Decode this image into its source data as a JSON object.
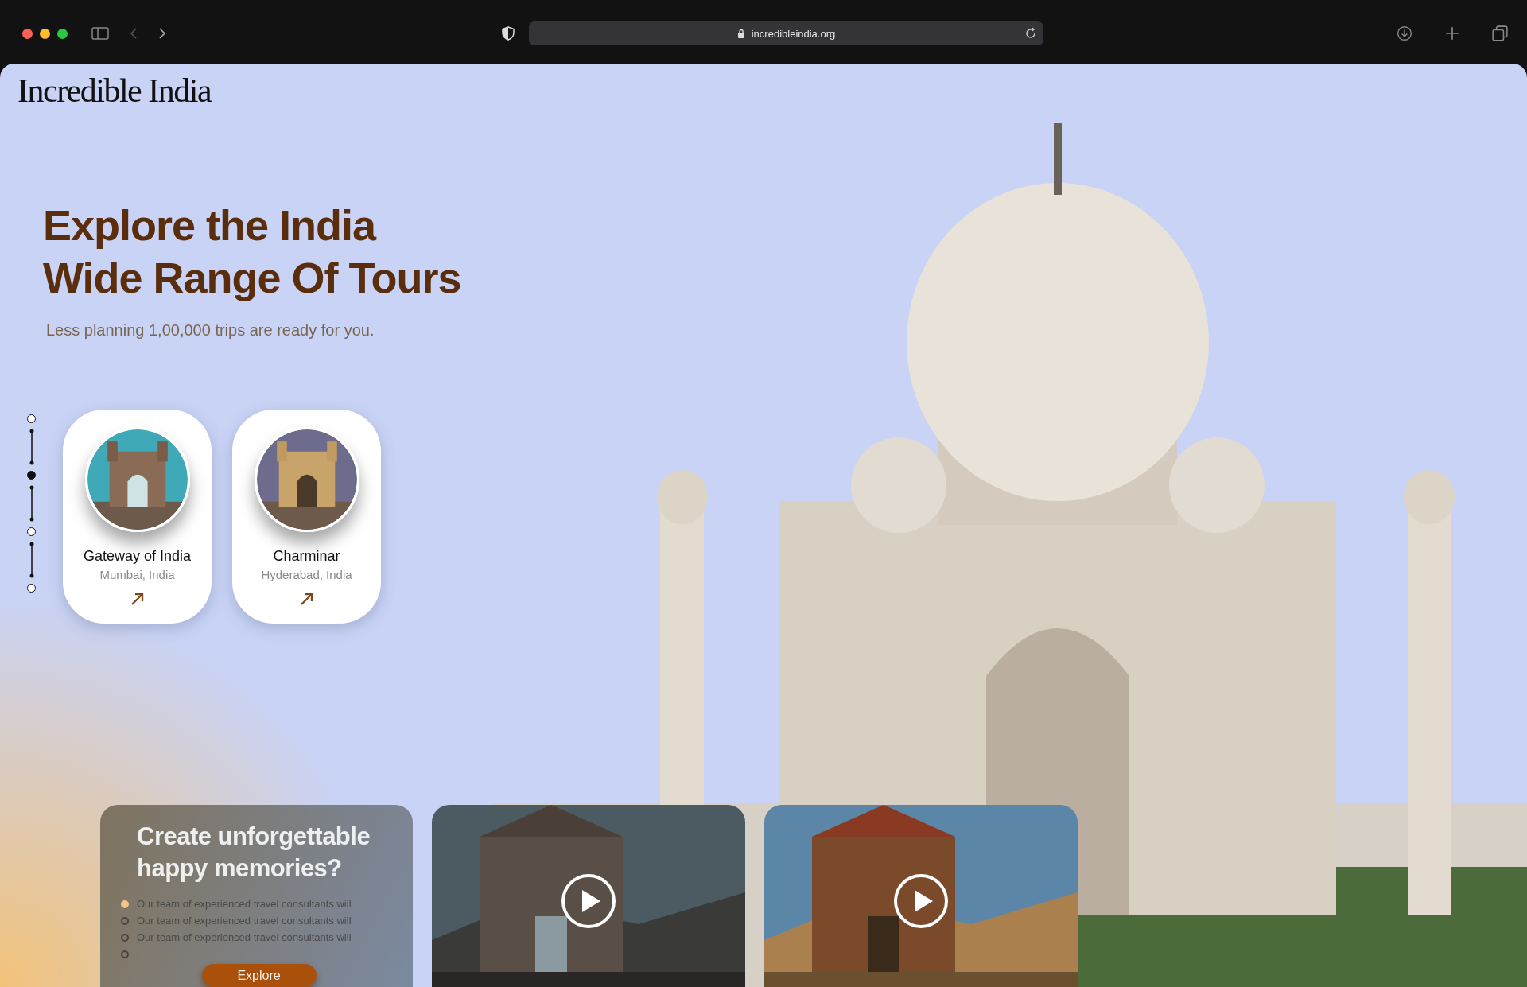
{
  "browser": {
    "url": "incredibleindia.org"
  },
  "logo": "Incredible India",
  "hero": {
    "title_lines": [
      "Explore the India",
      "Wide Range Of Tours"
    ],
    "subtitle": "Less planning 1,00,000 trips are ready for you."
  },
  "stepper": [
    {
      "selected": false
    },
    {
      "selected": true
    },
    {
      "selected": false
    },
    {
      "selected": false
    }
  ],
  "destinations": [
    {
      "name": "Gateway of India",
      "place": "Mumbai, India",
      "kind": "monument"
    },
    {
      "name": "Charminar",
      "place": "Hyderabad, India",
      "kind": "monument"
    }
  ],
  "promo": {
    "title": "Create unforgettable happy memories?",
    "bullets": [
      {
        "text": "Our team of experienced travel consultants will",
        "selected": true
      },
      {
        "text": "Our team of experienced travel consultants will",
        "selected": false
      },
      {
        "text": "Our team of experienced travel consultants will",
        "selected": false
      },
      {
        "selected": false
      }
    ],
    "button": "Explore"
  },
  "videos": [
    {
      "kind": "city"
    },
    {
      "kind": "temple"
    }
  ]
}
